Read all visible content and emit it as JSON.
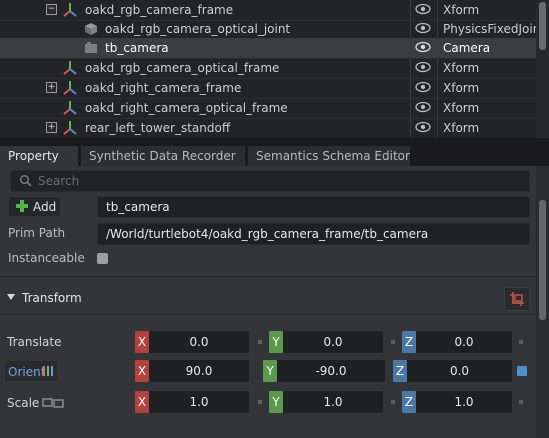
{
  "stage": {
    "rows": [
      {
        "name": "oakd_rgb_camera_frame",
        "type": "Xform",
        "expander": "−"
      },
      {
        "name": "oakd_rgb_camera_optical_joint",
        "type": "PhysicsFixedJoin"
      },
      {
        "name": "tb_camera",
        "type": "Camera",
        "selected": true
      },
      {
        "name": "oakd_rgb_camera_optical_frame",
        "type": "Xform"
      },
      {
        "name": "oakd_right_camera_frame",
        "type": "Xform",
        "expander": "+"
      },
      {
        "name": "oakd_right_camera_optical_frame",
        "type": "Xform"
      },
      {
        "name": "rear_left_tower_standoff",
        "type": "Xform",
        "expander": "+"
      }
    ]
  },
  "tabs": [
    "Property",
    "Synthetic Data Recorder",
    "Semantics Schema Editor"
  ],
  "property": {
    "search_placeholder": "Search",
    "add_label": "Add",
    "name_value": "tb_camera",
    "prim_path_label": "Prim Path",
    "prim_path_value": "/World/turtlebot4/oakd_rgb_camera_frame/tb_camera",
    "instanceable_label": "Instanceable",
    "transform_title": "Transform",
    "translate": {
      "label": "Translate",
      "x": "0.0",
      "y": "0.0",
      "z": "0.0"
    },
    "orient": {
      "label": "Orient",
      "x": "90.0",
      "y": "-90.0",
      "z": "0.0"
    },
    "scale": {
      "label": "Scale",
      "x": "1.0",
      "y": "1.0",
      "z": "1.0"
    },
    "axis_labels": {
      "x": "X",
      "y": "Y",
      "z": "Z"
    }
  },
  "colors": {
    "axis_x": "#b3423f",
    "axis_y": "#5b9a4c",
    "axis_z": "#4a79a8",
    "orient_label": "#6fa4e0"
  }
}
